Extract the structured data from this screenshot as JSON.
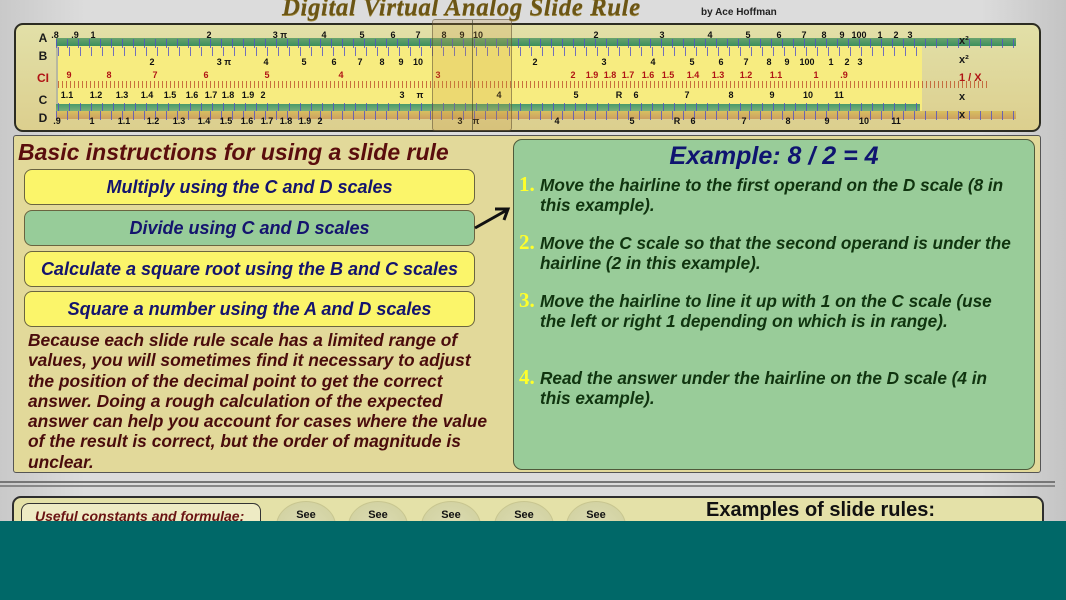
{
  "title": "Digital Virtual Analog Slide Rule",
  "byline": "by Ace Hoffman",
  "slide_rule": {
    "scales_left": [
      "A",
      "B",
      "CI",
      "C",
      "D"
    ],
    "scales_right": [
      "x²",
      "x²",
      "1 / X",
      "x",
      "x"
    ],
    "a_labels": [
      ".8",
      ".9",
      "1",
      "2",
      "3 π",
      "4",
      "5",
      "6",
      "7",
      "8",
      "9",
      "10",
      "2",
      "3",
      "4",
      "5",
      "6",
      "7",
      "8",
      "9",
      "100",
      "1",
      "2",
      "3"
    ],
    "b_labels": [
      "2",
      "3 π",
      "4",
      "5",
      "6",
      "7",
      "8",
      "9",
      "10",
      "2",
      "3",
      "4",
      "5",
      "6",
      "7",
      "8",
      "9",
      "100",
      "1",
      "2",
      "3"
    ],
    "ci_labels": [
      "9",
      "8",
      "7",
      "6",
      "5",
      "4",
      "3",
      "2",
      "1.9",
      "1.8",
      "1.7",
      "1.6",
      "1.5",
      "1.4",
      "1.3",
      "1.2",
      "1.1",
      "1",
      ".9"
    ],
    "c_labels": [
      "1.1",
      "1.2",
      "1.3",
      "1.4",
      "1.5",
      "1.6",
      "1.7",
      "1.8",
      "1.9",
      "2",
      "3",
      "π",
      "4",
      "5",
      "R",
      "6",
      "7",
      "8",
      "9",
      "10",
      "11"
    ],
    "d_labels": [
      ".9",
      "1",
      "1.1",
      "1.2",
      "1.3",
      "1.4",
      "1.5",
      "1.6",
      "1.7",
      "1.8",
      "1.9",
      "2",
      "3",
      "π",
      "4",
      "5",
      "R",
      "6",
      "7",
      "8",
      "9",
      "10",
      "11"
    ]
  },
  "instructions": {
    "heading": "Basic instructions for using a slide rule",
    "buttons": [
      {
        "label": "Multiply using the C and D scales",
        "active": false
      },
      {
        "label": "Divide using C and D scales",
        "active": true
      },
      {
        "label": "Calculate a square root using the B and C scales",
        "active": false
      },
      {
        "label": "Square a number using the A and D scales",
        "active": false
      }
    ],
    "note": "Because each slide rule scale has a limited range of values, you will sometimes find it necessary to adjust the position of the decimal point to get the correct answer. Doing a rough calculation of the expected answer can help you account for cases where the value of the result is correct, but the order of magnitude is unclear."
  },
  "example": {
    "title": "Example: 8 / 2 = 4",
    "steps": [
      {
        "num": "1.",
        "text": "Move the hairline to the first operand on the D scale (8 in this example)."
      },
      {
        "num": "2.",
        "text": "Move the C scale so that the second operand is under the hairline (2 in this example)."
      },
      {
        "num": "3.",
        "text": "Move the hairline to line it up with 1 on the C scale (use the left or right 1 depending on which is in range)."
      },
      {
        "num": "4.",
        "text": "Read the answer under the hairline on the D scale (4 in this example)."
      }
    ]
  },
  "bottom": {
    "constants_label": "Useful constants and formulae:",
    "see_buttons": [
      "See",
      "See",
      "See",
      "See",
      "See"
    ],
    "examples_heading": "Examples of slide rules:"
  },
  "colors": {
    "accent_active": "#97cc99",
    "button_yellow": "#fbf56a",
    "heading_maroon": "#5a0d0d",
    "step_number": "#ffff2a"
  }
}
